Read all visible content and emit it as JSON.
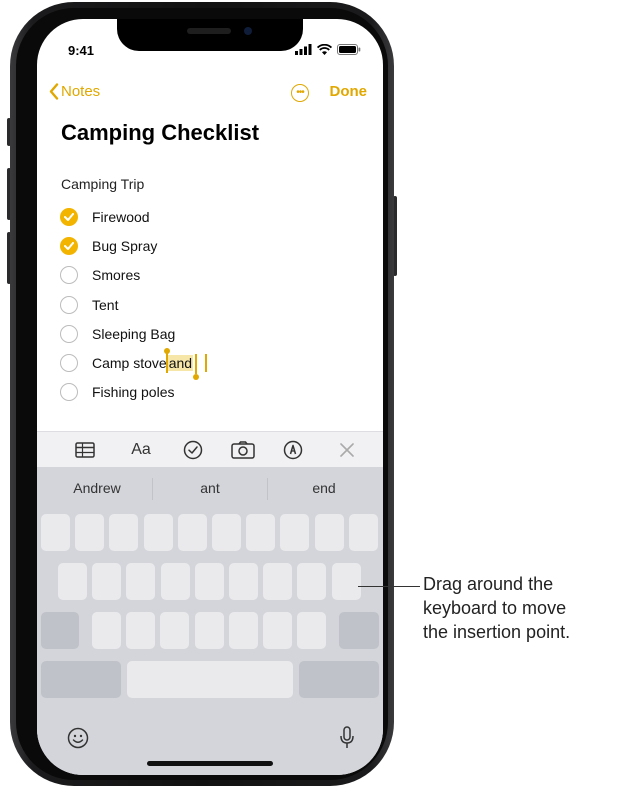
{
  "status_bar": {
    "time": "9:41"
  },
  "nav": {
    "back_label": "Notes",
    "done_label": "Done"
  },
  "note": {
    "title": "Camping Checklist",
    "section": "Camping Trip",
    "items": [
      {
        "label": "Firewood",
        "checked": true
      },
      {
        "label": "Bug Spray",
        "checked": true
      },
      {
        "label": "Smores",
        "checked": false
      },
      {
        "label": "Tent",
        "checked": false
      },
      {
        "label": "Sleeping Bag",
        "checked": false
      },
      {
        "label": "Camp stove",
        "checked": false,
        "selected_word": "and"
      },
      {
        "label": "Fishing poles",
        "checked": false
      }
    ]
  },
  "format_toolbar": {
    "icons": [
      "table-icon",
      "text-format-icon",
      "checklist-icon",
      "camera-icon",
      "markup-icon",
      "close-icon"
    ],
    "text_format_label": "Aa"
  },
  "keyboard": {
    "predictions": [
      "Andrew",
      "ant",
      "end"
    ],
    "icons": [
      "emoji-icon",
      "microphone-icon"
    ]
  },
  "callout": {
    "lines": [
      "Drag around the",
      "keyboard to move",
      "the insertion point."
    ]
  },
  "colors": {
    "accent": "#E0A800",
    "keyboard_bg": "#D3D5DA",
    "key": "#EAEAEC"
  }
}
